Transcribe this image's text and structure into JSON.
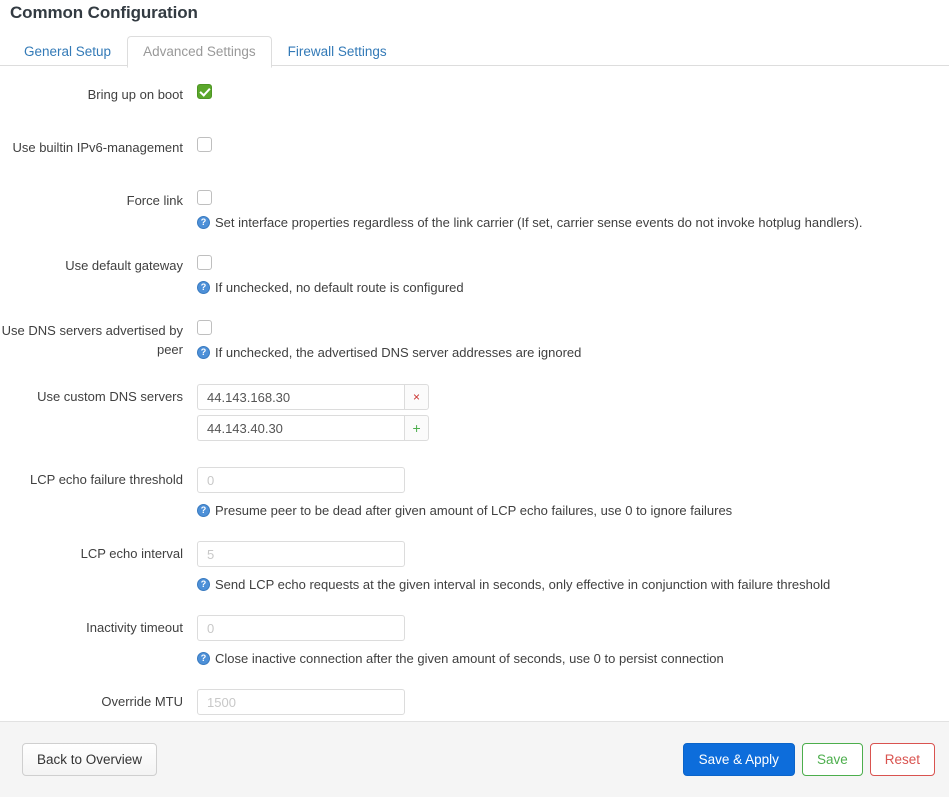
{
  "page": {
    "title": "Common Configuration"
  },
  "tabs": [
    {
      "label": "General Setup",
      "active": false
    },
    {
      "label": "Advanced Settings",
      "active": true
    },
    {
      "label": "Firewall Settings",
      "active": false
    }
  ],
  "form": {
    "bring_up_on_boot": {
      "label": "Bring up on boot",
      "checked": true
    },
    "ipv6_management": {
      "label": "Use builtin IPv6-management",
      "checked": false
    },
    "force_link": {
      "label": "Force link",
      "checked": false,
      "help": "Set interface properties regardless of the link carrier (If set, carrier sense events do not invoke hotplug handlers)."
    },
    "default_gateway": {
      "label": "Use default gateway",
      "checked": false,
      "help": "If unchecked, no default route is configured"
    },
    "dns_advertised": {
      "label": "Use DNS servers advertised by peer",
      "checked": false,
      "help": "If unchecked, the advertised DNS server addresses are ignored"
    },
    "custom_dns": {
      "label": "Use custom DNS servers",
      "entries": [
        {
          "value": "44.143.168.30",
          "button": "×",
          "button_kind": "remove"
        },
        {
          "value": "44.143.40.30",
          "button": "+",
          "button_kind": "add"
        }
      ]
    },
    "lcp_failure_threshold": {
      "label": "LCP echo failure threshold",
      "value": "",
      "placeholder": "0",
      "help": "Presume peer to be dead after given amount of LCP echo failures, use 0 to ignore failures"
    },
    "lcp_echo_interval": {
      "label": "LCP echo interval",
      "value": "",
      "placeholder": "5",
      "help": "Send LCP echo requests at the given interval in seconds, only effective in conjunction with failure threshold"
    },
    "inactivity_timeout": {
      "label": "Inactivity timeout",
      "value": "",
      "placeholder": "0",
      "help": "Close inactive connection after the given amount of seconds, use 0 to persist connection"
    },
    "override_mtu": {
      "label": "Override MTU",
      "value": "",
      "placeholder": "1500"
    }
  },
  "footer": {
    "back": "Back to Overview",
    "save_apply": "Save & Apply",
    "save": "Save",
    "reset": "Reset"
  },
  "colors": {
    "tab_link": "#337ab7",
    "checkbox_on": "#5aa72b",
    "primary": "#0d6ddb",
    "success": "#4cae4c",
    "danger": "#d9534f",
    "help_icon": "#4d90d8"
  }
}
